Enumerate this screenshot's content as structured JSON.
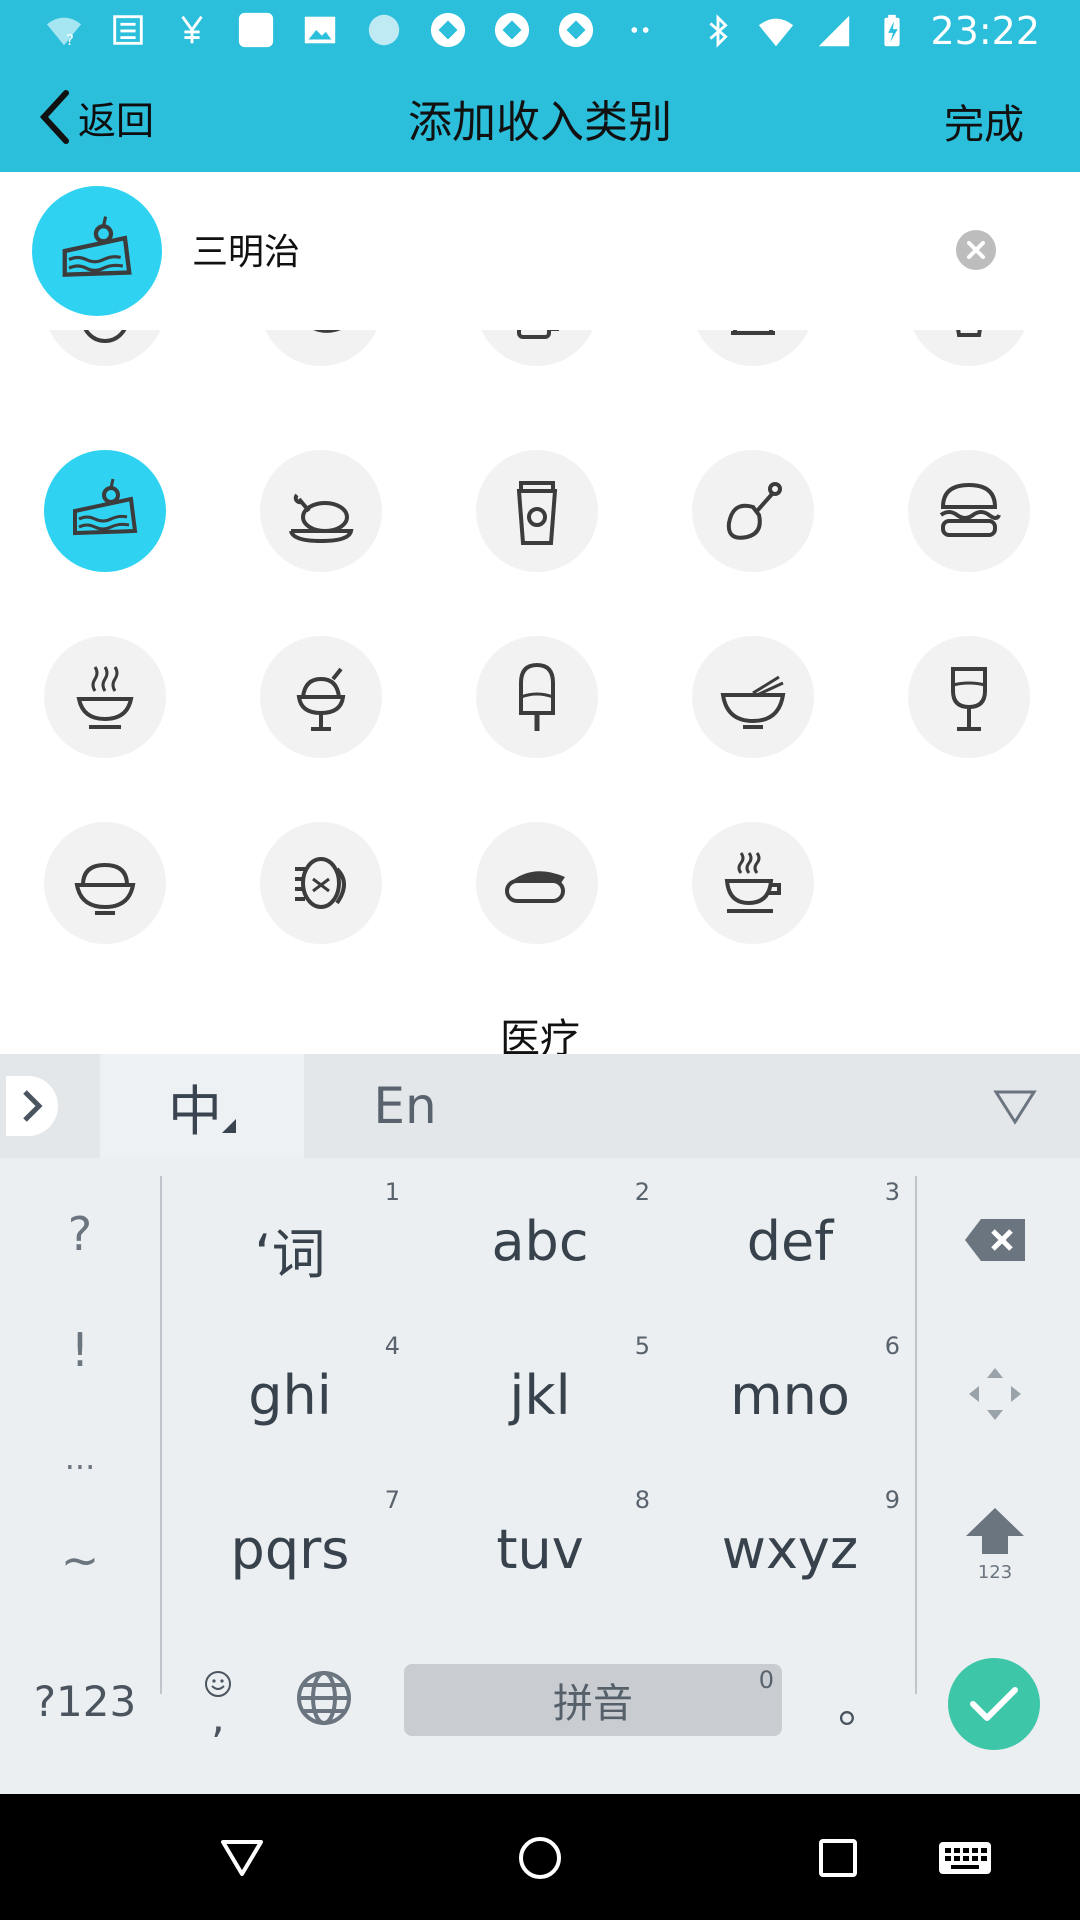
{
  "status": {
    "time": "23:22",
    "icons": [
      "wifi-question-icon",
      "news-icon",
      "yen-icon",
      "square-app-icon",
      "image-icon",
      "loading-icon",
      "app-icon",
      "app-icon",
      "app-icon",
      "more-dots-icon",
      "bluetooth-icon",
      "wifi-icon",
      "signal-icon",
      "battery-charging-icon"
    ]
  },
  "appbar": {
    "back_label": "返回",
    "title": "添加收入类别",
    "done_label": "完成"
  },
  "input": {
    "value": "三明治",
    "icon": "cake-icon"
  },
  "icon_grid": {
    "partial_row": [
      "round-icon",
      "leaf-icon",
      "mug-icon",
      "cake-tall-icon",
      "cup-icon"
    ],
    "rows": [
      [
        {
          "icon": "cake-icon",
          "selected": true
        },
        {
          "icon": "roast-chicken-icon"
        },
        {
          "icon": "coffee-cup-icon"
        },
        {
          "icon": "drumstick-icon"
        },
        {
          "icon": "burger-icon"
        }
      ],
      [
        {
          "icon": "hotpot-icon"
        },
        {
          "icon": "sundae-icon"
        },
        {
          "icon": "popsicle-icon"
        },
        {
          "icon": "noodle-bowl-icon"
        },
        {
          "icon": "wine-glass-icon"
        }
      ],
      [
        {
          "icon": "rice-bowl-icon"
        },
        {
          "icon": "crab-fish-icon"
        },
        {
          "icon": "sushi-icon"
        },
        {
          "icon": "tea-cup-icon"
        }
      ]
    ],
    "next_section_label": "医疗"
  },
  "keyboard": {
    "lang_zh": "中",
    "lang_en": "En",
    "side_keys": [
      "?",
      "!",
      "...",
      "~"
    ],
    "keys": [
      {
        "main": "‘词",
        "num": "1"
      },
      {
        "main": "abc",
        "num": "2"
      },
      {
        "main": "def",
        "num": "3"
      },
      {
        "main": "ghi",
        "num": "4"
      },
      {
        "main": "jkl",
        "num": "5"
      },
      {
        "main": "mno",
        "num": "6"
      },
      {
        "main": "pqrs",
        "num": "7"
      },
      {
        "main": "tuv",
        "num": "8"
      },
      {
        "main": "wxyz",
        "num": "9"
      }
    ],
    "shift_label": "123",
    "symbols_label": "?123",
    "comma_label": ",",
    "space_label": "拼音",
    "space_num": "0",
    "period_label": "。",
    "accent_color": "#3ec6a8"
  },
  "navbar": {
    "buttons": [
      "back-icon",
      "home-icon",
      "recents-icon",
      "keyboard-icon"
    ]
  },
  "colors": {
    "brand": "#2bbfdc",
    "selected": "#2fd3f1"
  }
}
